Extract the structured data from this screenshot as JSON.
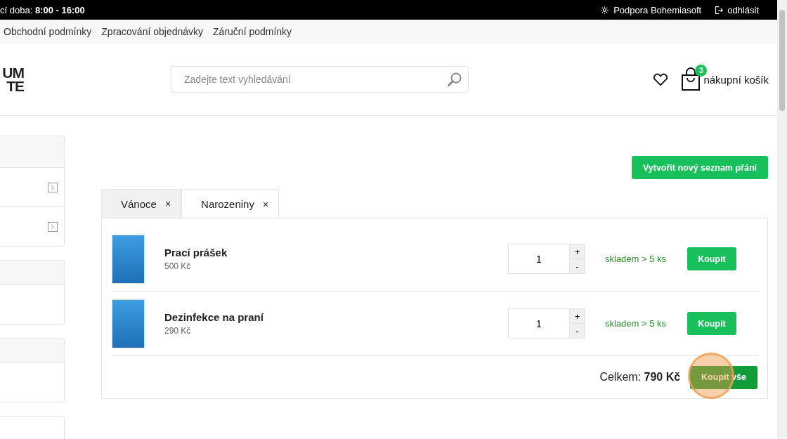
{
  "top_bar": {
    "hours": "cí doba: **8:00 - 16:00**",
    "links": [
      {
        "label": "Podpora Bohemiasoft",
        "kind": "gear"
      },
      {
        "label": "odhlásit",
        "kind": "logout"
      }
    ]
  },
  "nav": [
    "Obchodní podmínky",
    "Zpracování objednávky",
    "Záruční podmínky"
  ],
  "logo": [
    "UM",
    "TE"
  ],
  "search": {
    "placeholder": "Zadejte text vyhledávání"
  },
  "cart": {
    "count": "3",
    "label": "nákupní košík"
  },
  "create_button": "Vytvořit nový seznam přání",
  "tabs": [
    {
      "label": "Vánoce",
      "close": "×",
      "selected": false
    },
    {
      "label": "Narozeniny",
      "close": "×",
      "selected": true
    }
  ],
  "items": [
    {
      "name": "Prací prášek",
      "price": "500 Kč",
      "quantity": "1",
      "plus": "+",
      "minus": "-",
      "stock": "skladem > 5 ks",
      "buy": "Koupit"
    },
    {
      "name": "Dezinfekce na praní",
      "price": "290 Kč",
      "quantity": "1",
      "plus": "+",
      "minus": "-",
      "stock": "skladem > 5 ks",
      "buy": "Koupit"
    }
  ],
  "total": "Celkem: **790 Kč**",
  "buy_all": "Koupit vše"
}
